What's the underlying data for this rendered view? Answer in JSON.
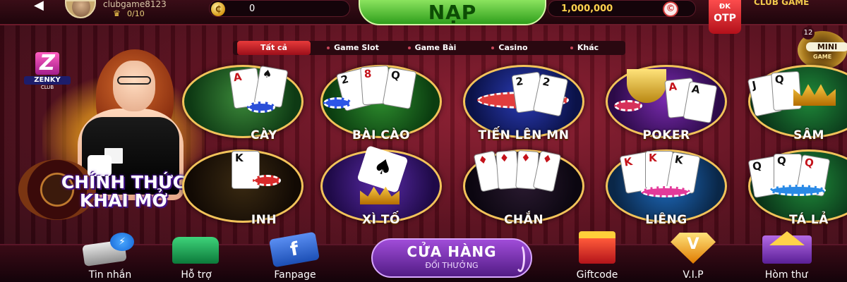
{
  "topbar": {
    "back_label": "◀",
    "username": "clubgame8123",
    "vip_level": "0/10",
    "coins": "0",
    "nap_label": "NẠP",
    "gold": "1,000,000",
    "gold_icon": "©",
    "otp_top": "ĐK",
    "otp_main": "OTP",
    "club_text": "CLUB GAME"
  },
  "promo": {
    "logo_letter": "Z",
    "logo_name": "ZENKY",
    "logo_sub": "CLUB",
    "title_line1": "CHÍNH THỨC",
    "title_line2": "KHAI MỞ"
  },
  "tabs": [
    {
      "label": "Tất cả",
      "active": true
    },
    {
      "label": "Game Slot",
      "active": false
    },
    {
      "label": "Game Bài",
      "active": false
    },
    {
      "label": "Casino",
      "active": false
    },
    {
      "label": "Khác",
      "active": false
    }
  ],
  "mini_game": {
    "count": "12",
    "label": "MINI",
    "sub": "GAME"
  },
  "games": [
    {
      "label": "CÀY"
    },
    {
      "label": "BÀI CÀO"
    },
    {
      "label": "TIẾN LÊN MN"
    },
    {
      "label": "POKER"
    },
    {
      "label": "SÂM"
    },
    {
      "label": "INH"
    },
    {
      "label": "XÌ TỐ"
    },
    {
      "label": "CHẮN"
    },
    {
      "label": "LIÊNG"
    },
    {
      "label": "TÁ LẢ"
    }
  ],
  "bottom_nav": [
    {
      "label": "Tin nhắn"
    },
    {
      "label": "Hỗ trợ"
    },
    {
      "label": "Fanpage"
    },
    {
      "label": "Giftcode"
    },
    {
      "label": "V.I.P"
    },
    {
      "label": "Hòm thư"
    }
  ],
  "shop": {
    "title": "CỬA HÀNG",
    "subtitle": "ĐỔI THƯỞNG"
  },
  "colors": {
    "accent_green": "#2f9e1c",
    "accent_red": "#d23a3a",
    "gold": "#f2c35a",
    "purple": "#7a30b8"
  }
}
